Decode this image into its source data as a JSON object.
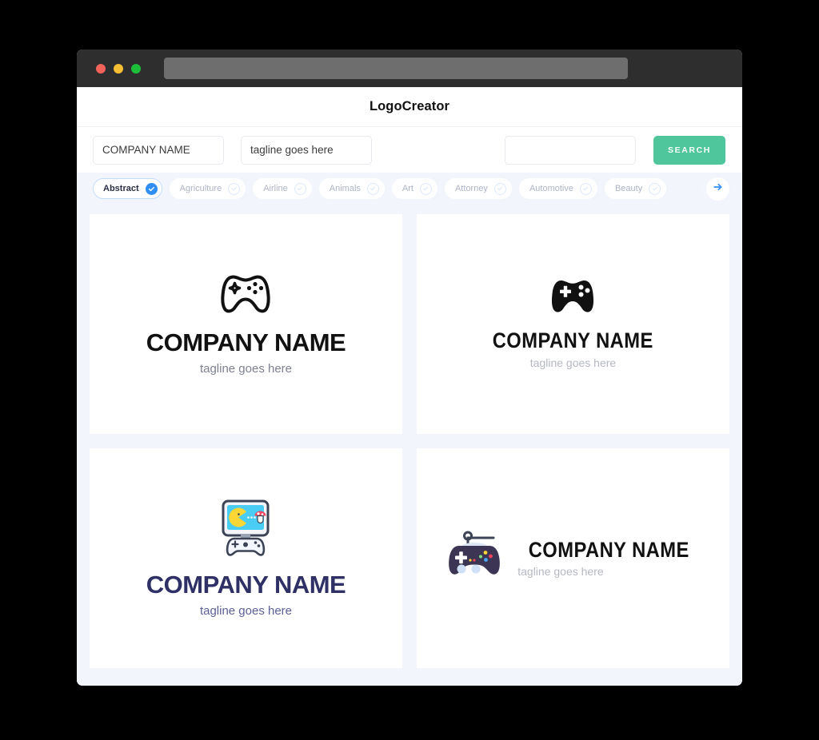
{
  "window": {
    "traffic_lights": [
      {
        "name": "close",
        "color": "#f4625a"
      },
      {
        "name": "minimize",
        "color": "#f5bf33"
      },
      {
        "name": "maximize",
        "color": "#1dbf3a"
      }
    ],
    "url_value": ""
  },
  "header": {
    "brand": "LogoCreator"
  },
  "search": {
    "company_value": "COMPANY NAME",
    "company_placeholder": "COMPANY NAME",
    "tagline_value": "tagline goes here",
    "tagline_placeholder": "tagline goes here",
    "extra_value": "",
    "extra_placeholder": "",
    "button_label": "SEARCH",
    "button_color": "#4fc69c"
  },
  "categories": {
    "active_index": 0,
    "accent_color": "#2f8ef4",
    "next_icon": "arrow-right-icon",
    "items": [
      {
        "label": "Abstract",
        "selected": true
      },
      {
        "label": "Agriculture",
        "selected": false
      },
      {
        "label": "Airline",
        "selected": false
      },
      {
        "label": "Animals",
        "selected": false
      },
      {
        "label": "Art",
        "selected": false
      },
      {
        "label": "Attorney",
        "selected": false
      },
      {
        "label": "Automotive",
        "selected": false
      },
      {
        "label": "Beauty",
        "selected": false
      }
    ]
  },
  "results": {
    "cards": [
      {
        "icon": "gamepad-outline-icon",
        "layout": "stacked",
        "style": "wide-bold",
        "company": "COMPANY NAME",
        "tagline": "tagline goes here",
        "text_color": "#111111",
        "tagline_color": "#7d8190"
      },
      {
        "icon": "gamepad-solid-icon",
        "layout": "stacked",
        "style": "condensed-bold",
        "company": "COMPANY NAME",
        "tagline": "tagline goes here",
        "text_color": "#111111",
        "tagline_color": "#b5b8c2"
      },
      {
        "icon": "arcade-screen-gamepad-icon",
        "layout": "stacked",
        "style": "wide-bold",
        "company": "COMPANY NAME",
        "tagline": "tagline goes here",
        "text_color": "#2f3166",
        "tagline_color": "#5b5f96"
      },
      {
        "icon": "gamepad-antenna-icon",
        "layout": "horizontal",
        "style": "condensed-bold",
        "company": "COMPANY NAME",
        "tagline": "tagline goes here",
        "text_color": "#111111",
        "tagline_color": "#b5b8c2"
      }
    ]
  }
}
